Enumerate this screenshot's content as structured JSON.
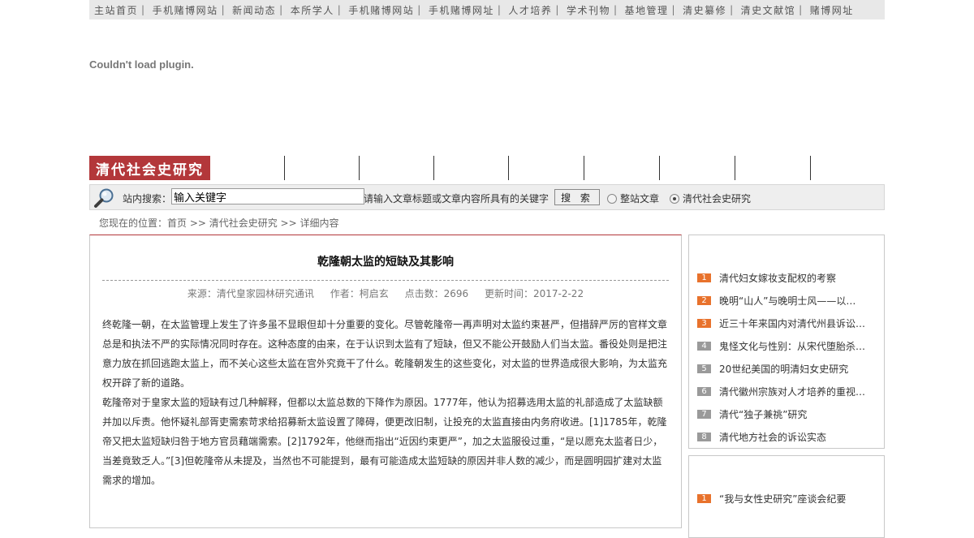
{
  "topnav": {
    "items": [
      "主站首页",
      "手机赌博网站",
      "新闻动态",
      "本所学人",
      "手机赌博网站",
      "手机赌博网址",
      "人才培养",
      "学术刊物",
      "基地管理",
      "清史纂修",
      "清史文献馆",
      "赌博网址"
    ],
    "separator": "|"
  },
  "plugin": {
    "message": "Couldn't load plugin."
  },
  "banner": {
    "logo_text": "清代社会史研究"
  },
  "search": {
    "label": "站内搜索：",
    "input_value": "输入关键字",
    "hint": "请输入文章标题或文章内容所具有的关键字",
    "button_label": "搜 索",
    "scope_options": [
      {
        "label": "整站文章",
        "selected": false
      },
      {
        "label": "清代社会史研究",
        "selected": true
      }
    ]
  },
  "breadcrumb": {
    "text": "您现在的位置：首页 >> 清代社会史研究 >> 详细内容"
  },
  "article": {
    "title": "乾隆朝太监的短缺及其影响",
    "source": "来源：清代皇家园林研究通讯",
    "author": "作者：柯启玄",
    "hits": "点击数：2696",
    "updated": "更新时间：2017-2-22",
    "paragraphs": [
      "终乾隆一朝，在太监管理上发生了许多虽不显眼但却十分重要的变化。尽管乾隆帝一再声明对太监约束甚严，但措辞严厉的官样文章总是和执法不严的实际情况同时存在。这种态度的由来，在于认识到太监有了短缺，但又不能公开鼓励人们当太监。番役处则是把注意力放在抓回逃跑太监上，而不关心这些太监在宫外究竟干了什么。乾隆朝发生的这些变化，对太监的世界造成很大影响，为太监充权开辟了新的道路。",
      "乾隆帝对于皇家太监的短缺有过几种解释，但都以太监总数的下降作为原因。1777年，他认为招募选用太监的礼部造成了太监缺额并加以斥责。他怀疑礼部胥吏需索苛求给招募新太监设置了障碍，便更改旧制，让投充的太监直接由内务府收进。[1]1785年，乾隆帝又把太监短缺归咎于地方官员藉端需索。[2]1792年，他继而指出“近因约束更严”，加之太监服役过重，“是以愿充太监者日少，当差竟致乏人。”[3]但乾隆帝从未提及，当然也不可能提到，最有可能造成太监短缺的原因并非人数的减少，而是圆明园扩建对太监需求的增加。"
    ]
  },
  "sidebar1": {
    "items": [
      {
        "num": "1",
        "title": "清代妇女嫁妆支配权的考察"
      },
      {
        "num": "2",
        "title": "晚明“山人”与晚明士风——以…"
      },
      {
        "num": "3",
        "title": "近三十年来国内对清代州县诉讼…"
      },
      {
        "num": "4",
        "title": "鬼怪文化与性别：从宋代堕胎杀…"
      },
      {
        "num": "5",
        "title": "20世纪美国的明清妇女史研究"
      },
      {
        "num": "6",
        "title": "清代徽州宗族对人才培养的重视…"
      },
      {
        "num": "7",
        "title": "清代“独子兼祧”研究"
      },
      {
        "num": "8",
        "title": "清代地方社会的诉讼实态"
      }
    ]
  },
  "sidebar2": {
    "items": [
      {
        "num": "1",
        "title": "“我与女性史研究”座谈会纪要"
      }
    ]
  },
  "colors": {
    "accent_red": "#b3373a",
    "rank_hot": "#e8722c",
    "rank_cool": "#9a9a9a"
  }
}
